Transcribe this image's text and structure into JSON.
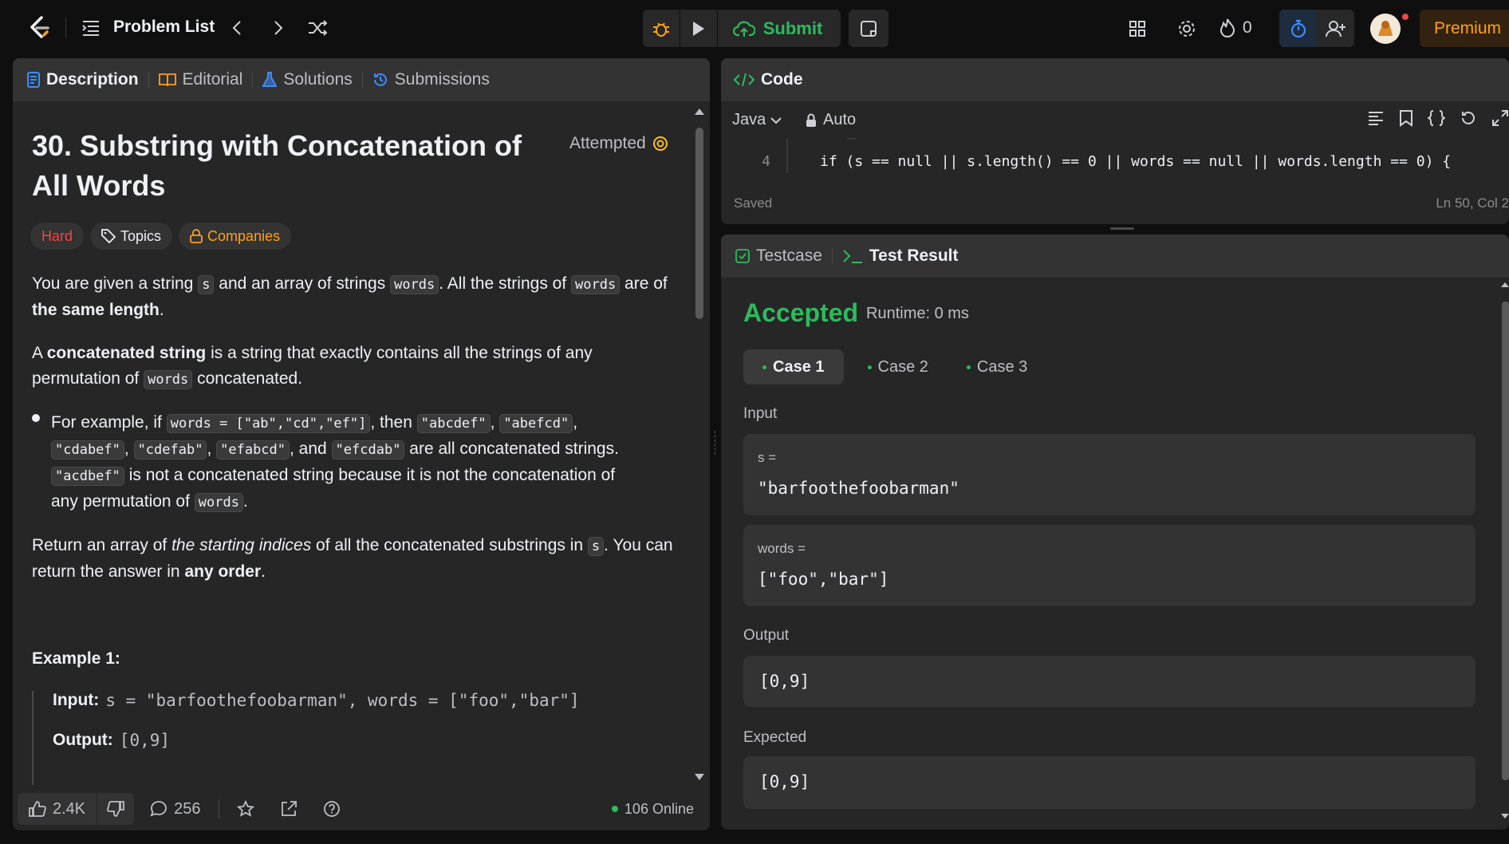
{
  "topbar": {
    "problem_list": "Problem List",
    "submit_label": "Submit",
    "streak_count": "0",
    "premium_label": "Premium"
  },
  "left_panel": {
    "tabs": [
      {
        "label": "Description"
      },
      {
        "label": "Editorial"
      },
      {
        "label": "Solutions"
      },
      {
        "label": "Submissions"
      }
    ],
    "title": "30. Substring with Concatenation of All Words",
    "attempted_label": "Attempted",
    "difficulty": "Hard",
    "topics_label": "Topics",
    "companies_label": "Companies",
    "p1": {
      "a": "You are given a string ",
      "code1": "s",
      "b": " and an array of strings ",
      "code2": "words",
      "c": ". All the strings of ",
      "code3": "words",
      "d": " are of ",
      "bold": "the same length",
      "e": "."
    },
    "p2": {
      "a": "A ",
      "bold": "concatenated string",
      "b": " is a string that exactly contains all the strings of any permutation of ",
      "code": "words",
      "c": " concatenated."
    },
    "bullet": {
      "a": "For example, if ",
      "c1": "words = [\"ab\",\"cd\",\"ef\"]",
      "b": ", then ",
      "c2": "\"abcdef\"",
      "sep1": ", ",
      "c3": "\"abefcd\"",
      "sep2": ", ",
      "c4": "\"cdabef\"",
      "sep3": ", ",
      "c5": "\"cdefab\"",
      "sep4": ", ",
      "c6": "\"efabcd\"",
      "c": ", and ",
      "c7": "\"efcdab\"",
      "d": " are all concatenated strings. ",
      "c8": "\"acdbef\"",
      "e": " is not a concatenated string because it is not the concatenation of any permutation of ",
      "c9": "words",
      "f": "."
    },
    "p3": {
      "a": "Return an array of ",
      "italic": "the starting indices",
      "b": " of all the concatenated substrings in ",
      "code": "s",
      "c": ". You can return the answer in ",
      "bold": "any order",
      "d": "."
    },
    "example_title": "Example 1:",
    "example_input_label": "Input:",
    "example_input_value": "s = \"barfoothefoobarman\", words = [\"foo\",\"bar\"]",
    "example_output_label": "Output:",
    "example_output_value": "[0,9]",
    "likes": "2.4K",
    "comments": "256",
    "online": "106 Online"
  },
  "code_panel": {
    "title": "Code",
    "language": "Java",
    "auto_label": "Auto",
    "line_number": "4",
    "code_line": "if (s == null || s.length() == 0 || words == null || words.length == 0) {",
    "saved_label": "Saved",
    "cursor_pos": "Ln 50, Col 2"
  },
  "result_panel": {
    "tabs": [
      {
        "label": "Testcase"
      },
      {
        "label": "Test Result"
      }
    ],
    "status": "Accepted",
    "runtime": "Runtime: 0 ms",
    "cases": [
      {
        "label": "Case 1"
      },
      {
        "label": "Case 2"
      },
      {
        "label": "Case 3"
      }
    ],
    "input_label": "Input",
    "s_label": "s =",
    "s_value": "\"barfoothefoobarman\"",
    "words_label": "words =",
    "words_value": "[\"foo\",\"bar\"]",
    "output_label": "Output",
    "output_value": "[0,9]",
    "expected_label": "Expected",
    "expected_value": "[0,9]"
  },
  "colors": {
    "accent": "#ffa116",
    "accepted": "#2cbb5d",
    "hard": "#ef4743",
    "blue": "#3c8dff"
  }
}
